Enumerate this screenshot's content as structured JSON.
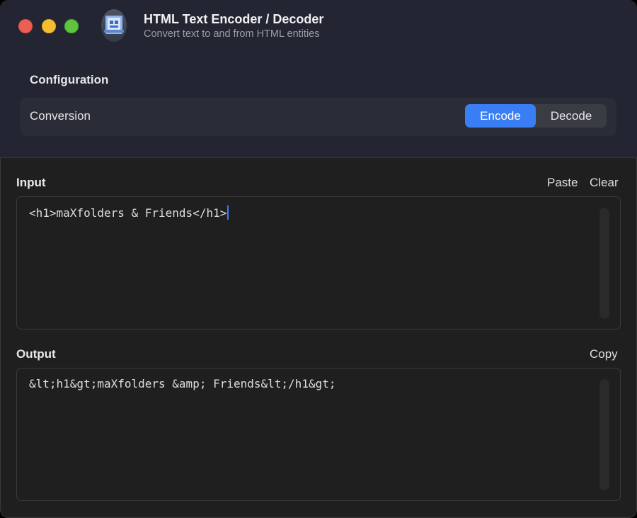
{
  "window": {
    "title": "HTML Text Encoder / Decoder",
    "subtitle": "Convert text to and from HTML entities"
  },
  "configuration": {
    "heading": "Configuration",
    "row_label": "Conversion",
    "modes": [
      "Encode",
      "Decode"
    ],
    "selected_mode": "Encode"
  },
  "input": {
    "label": "Input",
    "paste_label": "Paste",
    "clear_label": "Clear",
    "value": "<h1>maXfolders & Friends</h1>"
  },
  "output": {
    "label": "Output",
    "copy_label": "Copy",
    "value": "&lt;h1&gt;maXfolders &amp; Friends&lt;/h1&gt;"
  },
  "colors": {
    "accent": "#3a7ef5",
    "header_bg": "#232632",
    "body_bg": "#1f1f1f"
  },
  "icons": [
    "close-window-button",
    "minimize-window-button",
    "zoom-window-button",
    "app-icon"
  ]
}
